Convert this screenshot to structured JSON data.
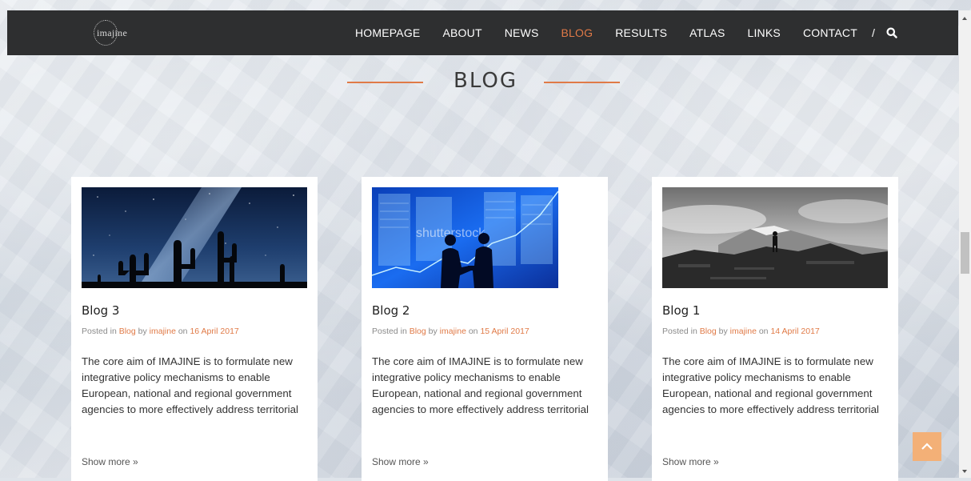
{
  "header": {
    "logo_text": "imajine",
    "nav": [
      "HOMEPAGE",
      "ABOUT",
      "NEWS",
      "BLOG",
      "RESULTS",
      "ATLAS",
      "LINKS",
      "CONTACT"
    ],
    "active": "BLOG",
    "separator": "/",
    "search_icon": "search-icon"
  },
  "page": {
    "title": "BLOG"
  },
  "cards": [
    {
      "title": "Blog 3",
      "posted_in": "Posted in",
      "category": "Blog",
      "by": "by",
      "author": "imajine",
      "on": "on",
      "date": "16 April 2017",
      "excerpt": "The core aim of IMAJINE is to formulate new integrative policy mechanisms to enable European, national and regional government agencies to more effectively address territorial",
      "more": "Show more »",
      "image_icon": "night-sky-cactus-image"
    },
    {
      "title": "Blog 2",
      "posted_in": "Posted in",
      "category": "Blog",
      "by": "by",
      "author": "imajine",
      "on": "on",
      "date": "15 April 2017",
      "excerpt": "The core aim of IMAJINE is to formulate new integrative policy mechanisms to enable European, national and regional government agencies to more effectively address territorial",
      "more": "Show more »",
      "image_icon": "business-handshake-image",
      "image_watermark": "shutterstock"
    },
    {
      "title": "Blog 1",
      "posted_in": "Posted in",
      "category": "Blog",
      "by": "by",
      "author": "imajine",
      "on": "on",
      "date": "14 April 2017",
      "excerpt": "The core aim of IMAJINE is to formulate new integrative policy mechanisms to enable European, national and regional government agencies to more effectively address territorial",
      "more": "Show more »",
      "image_icon": "mountain-hiker-image"
    }
  ],
  "colors": {
    "accent": "#e07a47",
    "topbar": "#2e2f30",
    "backtop": "#f3b077"
  },
  "back_to_top_icon": "chevron-up-icon"
}
